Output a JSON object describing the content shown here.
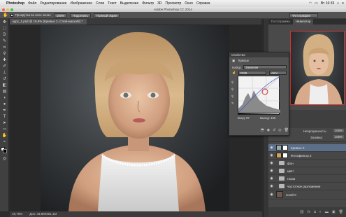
{
  "menubar": {
    "app": "Photoshop",
    "items": [
      "Файл",
      "Редактирование",
      "Изображение",
      "Слои",
      "Текст",
      "Выделение",
      "Фильтр",
      "3D",
      "Просмотр",
      "Окно",
      "Справка"
    ],
    "clock": "Вт 16:33"
  },
  "window": {
    "title": "Adobe Photoshop CC 2014"
  },
  "options": {
    "scroll_all_label": "Прокрутка во всех окнах",
    "zoom_btn": "100%",
    "fit_btn": "Подогнать",
    "fill_btn": "Полный экран",
    "workspace": "Фотография"
  },
  "document": {
    "tab": "курс_1.psd @ 19,6% (Кривые 2, Слой-маска/8) *",
    "zoom": "19,79%",
    "docsize": "Док: 43,8M/361,1M"
  },
  "panels": {
    "history_tab": "Гистограмма",
    "navigator_tab": "Навигатор",
    "properties_tab": "Свойства",
    "curves_title": "Кривые",
    "preset_label": "Набор:",
    "preset_value": "Заказная",
    "channel_value": "RGB",
    "auto_btn": "Авто",
    "input_label": "Вход: 87",
    "output_label": "Выход: 155"
  },
  "layers": {
    "opacity_label": "Непрозрачность:",
    "opacity_value": "100%",
    "fill_label": "Заливка:",
    "fill_value": "100%",
    "rows": [
      {
        "label": "Кривые 2",
        "kind": "adjust",
        "selected": true
      },
      {
        "label": "Фотофильтр 2",
        "kind": "adjust",
        "selected": false
      },
      {
        "label": "фон",
        "kind": "folder",
        "selected": false
      },
      {
        "label": "цвет",
        "kind": "folder",
        "selected": false
      },
      {
        "label": "глаза",
        "kind": "folder",
        "selected": false
      },
      {
        "label": "частотное разложение",
        "kind": "folder",
        "selected": false
      },
      {
        "label": "Слой 0",
        "kind": "pixel",
        "selected": false
      }
    ]
  },
  "colors": {
    "accent": "#5d6f88",
    "nav_frame": "#dd3333",
    "curve_point": "#cc2222"
  }
}
